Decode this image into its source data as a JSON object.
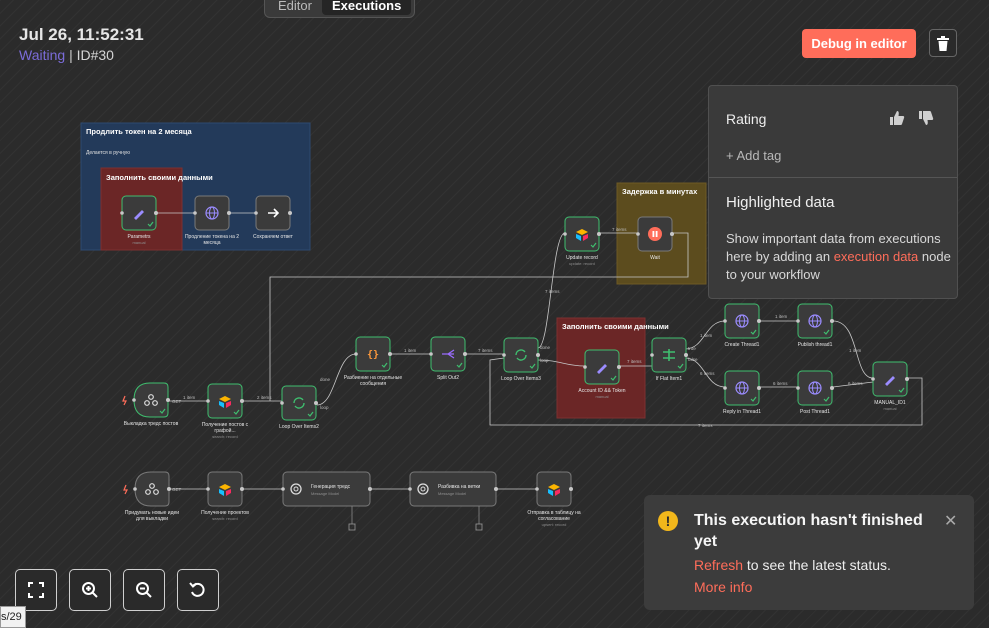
{
  "tabs": {
    "editor": "Editor",
    "executions": "Executions"
  },
  "header": {
    "timestamp": "Jul 26, 11:52:31",
    "status": "Waiting",
    "separator": "|",
    "id": "ID#30",
    "debug_label": "Debug in editor"
  },
  "panel": {
    "rating": "Rating",
    "add_tag": "+ Add tag",
    "highlighted": "Highlighted data",
    "desc_1": "Show important data from executions here by adding an ",
    "desc_link": "execution data",
    "desc_2": " node to your workflow"
  },
  "toast": {
    "title": "This execution hasn't finished yet",
    "refresh": "Refresh",
    "refresh_rest": " to see the latest status.",
    "more": "More info"
  },
  "corner": "s/29",
  "sticky_notes": [
    {
      "title": "Продлить токен на 2 месяца",
      "body": "Делается в ручную"
    },
    {
      "title": "Заполнить своими данными",
      "body": ""
    },
    {
      "title": "Задержка в минутах",
      "body": ""
    },
    {
      "title": "Заполнить своими данными",
      "body": ""
    }
  ],
  "nodes": {
    "parametrs": {
      "label": "Parametrs",
      "sub": "manual"
    },
    "prolong": {
      "label": "Продление токена на 2 месяца",
      "sub": ""
    },
    "save": {
      "label": "Сохраняем ответ",
      "sub": ""
    },
    "wh1": {
      "label": "Выкладка тредс постов",
      "sub": ""
    },
    "get_posts": {
      "label": "Получение постов с графой...",
      "sub": "search: record"
    },
    "loop2": {
      "label": "Loop Over Items2",
      "sub": ""
    },
    "split_msgs": {
      "label": "Разбиение на отдельные сообщения",
      "sub": ""
    },
    "splitout2": {
      "label": "Split Out2",
      "sub": ""
    },
    "loop3": {
      "label": "Loop Over Items3",
      "sub": ""
    },
    "update": {
      "label": "Update record",
      "sub": "update: record"
    },
    "wait": {
      "label": "Wait",
      "sub": ""
    },
    "account": {
      "label": "Account ID && Token",
      "sub": "manual"
    },
    "ifflat": {
      "label": "If Flat Item1",
      "sub": ""
    },
    "create": {
      "label": "Create Thread1",
      "sub": ""
    },
    "publish": {
      "label": "Publish thread1",
      "sub": ""
    },
    "reply": {
      "label": "Reply in Thread1",
      "sub": ""
    },
    "post": {
      "label": "Post Thread1",
      "sub": ""
    },
    "manual": {
      "label": "MANUAL_ID1",
      "sub": "manual"
    },
    "wh2": {
      "label": "Придумать новые идеи для выкладки",
      "sub": ""
    },
    "get_projects": {
      "label": "Получение проектов",
      "sub": "search: record"
    },
    "gen": {
      "label": "Генерация тредс",
      "sub": "Message Model"
    },
    "split_lines": {
      "label": "Разбивка на ветки",
      "sub": "Message Model"
    },
    "send": {
      "label": "Отправка в таблицу на согласование",
      "sub": "upsert: record"
    }
  },
  "edges": {
    "one": "1 item",
    "two": "2 items",
    "seven": "7 items",
    "six": "6 items",
    "done": "done",
    "loop": "loop",
    "true": "true",
    "false": "false",
    "get": "GET"
  },
  "colors": {
    "accent": "#ff6d5a",
    "waiting": "#7b6cd9",
    "success": "#3fbf6f",
    "node_bg": "#3b3b3b"
  }
}
